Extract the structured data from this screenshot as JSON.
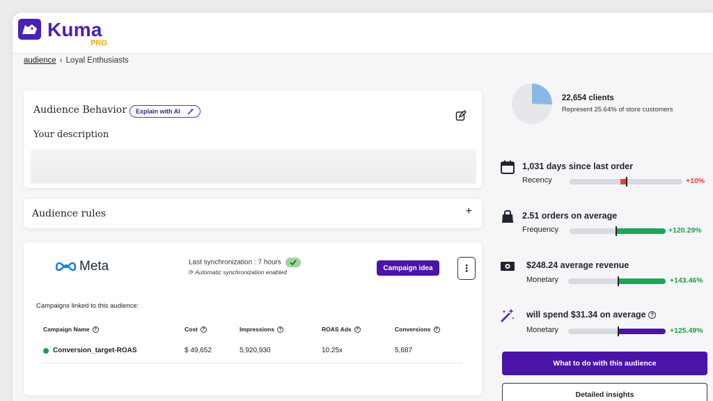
{
  "brand": {
    "name": "Kuma",
    "tier": "PRO",
    "color": "#4a1fb8",
    "tier_color": "#f0a500"
  },
  "breadcrumb": {
    "parent": "audience",
    "separator": "‹",
    "current": "Loyal Enthusiasts"
  },
  "behavior": {
    "title": "Audience Behavior",
    "ai_button": "Explain with AI",
    "ai_icon": "magic-wand-icon",
    "edit_icon": "edit-icon",
    "description_label": "Your description"
  },
  "rules": {
    "title": "Audience rules",
    "toggle": "+"
  },
  "meta": {
    "platform": "Meta",
    "sync_text": "Last synchronization : 7 hours",
    "sync_status_icon": "check-icon",
    "auto_sync_text": "Automatic synchronization enabled",
    "campaign_button": "Campaign idea",
    "more_button": "⋮",
    "linked_label": "Campaigns linked to this audience:",
    "columns": [
      "Campaign Name",
      "Cost",
      "Impressions",
      "ROAS Ads",
      "Conversions"
    ],
    "rows": [
      {
        "name": "Conversion_target-ROAS",
        "cost": "$ 49,652",
        "impressions": "5,920,930",
        "roas": "10.25x",
        "conversions": "5,687",
        "status_color": "#1a9e4a"
      }
    ]
  },
  "summary": {
    "clients": "22,654 clients",
    "subtitle": "Represent 25.64% of store customers",
    "share": 0.2564
  },
  "metrics": [
    {
      "icon": "calendar-icon",
      "title": "1,031 days since last order",
      "label": "Recency",
      "change": "+10%",
      "change_color": "#e0453a",
      "fill_color": "#e0453a"
    },
    {
      "icon": "shopping-bag-icon",
      "title": "2.51 orders on average",
      "label": "Frequency",
      "change": "+120.29%",
      "change_color": "#1a9e4a",
      "fill_color": "#1aa65a"
    },
    {
      "icon": "money-icon",
      "title": "$248.24 average revenue",
      "label": "Monetary",
      "change": "+143.46%",
      "change_color": "#1a9e4a",
      "fill_color": "#1aa65a"
    },
    {
      "icon": "magic-wand-icon",
      "title": "will spend $31.34 on average",
      "label": "Monetary",
      "change": "+125.49%",
      "change_color": "#1a9e4a",
      "fill_color": "#4a14a8",
      "help_icon": "help-icon"
    }
  ],
  "actions": {
    "primary": "What to do with this audience",
    "secondary": "Detailed insights"
  }
}
